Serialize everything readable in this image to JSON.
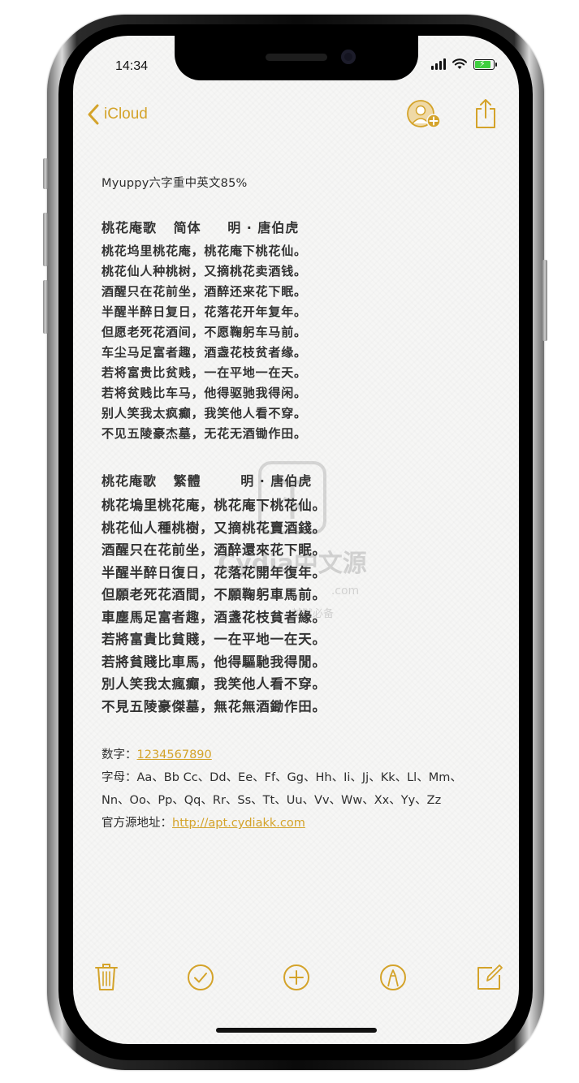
{
  "status_bar": {
    "time": "14:34"
  },
  "nav": {
    "back_label": "iCloud"
  },
  "note": {
    "font_title": "Myuppy六字重中英文85%",
    "poem_simplified": {
      "title": "桃花庵歌",
      "variant": "简体",
      "author": "明 · 唐伯虎",
      "lines": [
        "桃花坞里桃花庵，桃花庵下桃花仙。",
        "桃花仙人种桃树，又摘桃花卖酒钱。",
        "酒醒只在花前坐，酒醉还来花下眠。",
        "半醒半醉日复日，花落花开年复年。",
        "但愿老死花酒间，不愿鞠躬车马前。",
        "车尘马足富者趣，酒盏花枝贫者缘。",
        "若将富贵比贫贱，一在平地一在天。",
        "若将贫贱比车马，他得驱驰我得闲。",
        "别人笑我太疯癫，我笑他人看不穿。",
        "不见五陵豪杰墓，无花无酒锄作田。"
      ]
    },
    "poem_traditional": {
      "title": "桃花庵歌",
      "variant": "繁體",
      "author": "明 · 唐伯虎",
      "lines": [
        "桃花塢里桃花庵，桃花庵下桃花仙。",
        "桃花仙人種桃樹，又摘桃花賣酒錢。",
        "酒醒只在花前坐，酒醉還來花下眠。",
        "半醒半醉日復日，花落花開年復年。",
        "但願老死花酒間，不願鞠躬車馬前。",
        "車塵馬足富者趣，酒盞花枝貧者緣。",
        "若將富貴比貧賤，一在平地一在天。",
        "若將貧賤比車馬，他得驅馳我得閒。",
        "別人笑我太瘋癲，我笑他人看不穿。",
        "不見五陵豪傑墓，無花無酒鋤作田。"
      ]
    },
    "digits_label": "数字：",
    "digits_value": "1234567890",
    "letters_label": "字母：",
    "letters_line1": "Aa、Bb Cc、Dd、Ee、Ff、Gg、Hh、Ii、Jj、Kk、Ll、Mm、",
    "letters_line2": "Nn、Oo、Pp、Qq、Rr、Ss、Tt、Uu、Vv、Ww、Xx、Yy、Zz",
    "source_label": "官方源地址：",
    "source_url": "http://apt.cydiakk.com"
  },
  "watermark": {
    "text": "Cydia中文源",
    "domain": ".com",
    "sub": "越狱必备"
  },
  "colors": {
    "accent": "#d4a32a",
    "paper": "#f6f6f5",
    "text": "#2e2e2e"
  },
  "icons": {
    "nav": [
      "chevron-left-icon",
      "add-people-icon",
      "share-icon"
    ],
    "toolbar": [
      "trash-icon",
      "checklist-icon",
      "add-icon",
      "markup-icon",
      "compose-icon"
    ]
  }
}
